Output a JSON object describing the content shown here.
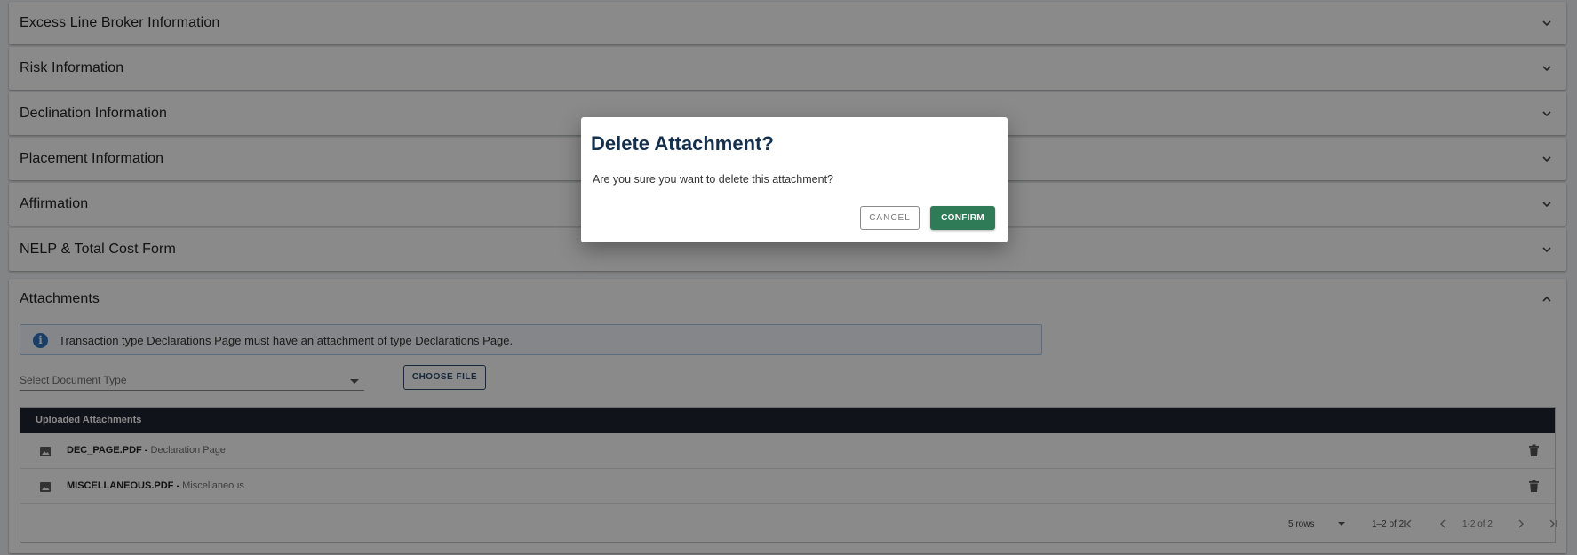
{
  "sections": [
    {
      "label": "Excess Line Broker Information",
      "expanded": false
    },
    {
      "label": "Risk Information",
      "expanded": false
    },
    {
      "label": "Declination Information",
      "expanded": false
    },
    {
      "label": "Placement Information",
      "expanded": false
    },
    {
      "label": "Affirmation",
      "expanded": false
    },
    {
      "label": "NELP & Total Cost Form",
      "expanded": false
    }
  ],
  "attachments": {
    "title": "Attachments",
    "expanded": true,
    "info_message": "Transaction type Declarations Page must have an attachment of type Declarations Page.",
    "select_placeholder": "Select Document Type",
    "choose_file_label": "CHOOSE FILE",
    "table_title": "Uploaded Attachments",
    "rows": [
      {
        "file": "DEC_PAGE.PDF -",
        "type": " Declaration Page"
      },
      {
        "file": "MISCELLANEOUS.PDF -",
        "type": " Miscellaneous"
      }
    ],
    "pager": {
      "rows_per_page": "5 rows",
      "range": "1–2 of 2",
      "range_nav": "1-2 of 2"
    }
  },
  "dialog": {
    "title": "Delete Attachment?",
    "message": "Are you sure you want to delete this attachment?",
    "cancel_label": "CANCEL",
    "confirm_label": "CONFIRM"
  },
  "colors": {
    "confirm": "#2f7a57",
    "dialog_title": "#14304d",
    "table_header": "#1e2430",
    "info_icon": "#2f74c0"
  },
  "icons": {
    "section_collapsed": "chevron-down-icon",
    "section_expanded": "chevron-up-icon",
    "row": "image-icon",
    "row_action": "trash-icon",
    "info": "info-icon"
  }
}
